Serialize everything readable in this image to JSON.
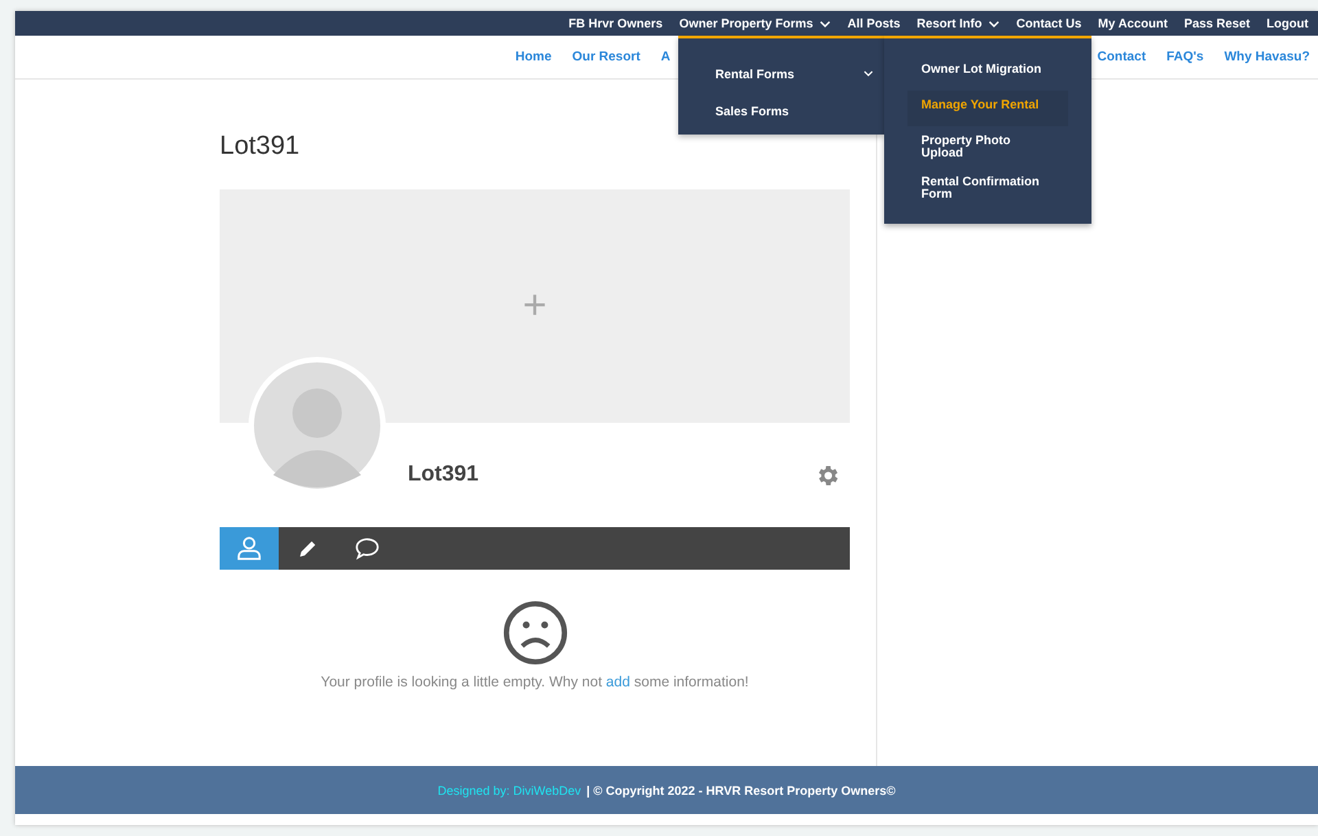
{
  "top_menu": [
    {
      "label": "FB Hrvr Owners",
      "has_submenu": false
    },
    {
      "label": "Owner Property Forms",
      "has_submenu": true
    },
    {
      "label": "All Posts",
      "has_submenu": false
    },
    {
      "label": "Resort Info",
      "has_submenu": true
    },
    {
      "label": "Contact Us",
      "has_submenu": false
    },
    {
      "label": "My Account",
      "has_submenu": false
    },
    {
      "label": "Pass Reset",
      "has_submenu": false
    },
    {
      "label": "Logout",
      "has_submenu": false
    }
  ],
  "main_menu": [
    "Home",
    "Our Resort",
    "A",
    "Contact",
    "FAQ's",
    "Why Havasu?"
  ],
  "dropdown": [
    {
      "label": "Rental Forms",
      "has_submenu": true
    },
    {
      "label": "Sales Forms",
      "has_submenu": false
    }
  ],
  "submenu": [
    {
      "label": "Owner Lot Migration",
      "selected": false
    },
    {
      "label": "Manage Your Rental",
      "selected": true
    },
    {
      "label": "Property Photo Upload",
      "selected": false
    },
    {
      "label": "Rental Confirmation Form",
      "selected": false
    }
  ],
  "page_title": "Lot391",
  "profile": {
    "name": "Lot391",
    "cover_add": "+"
  },
  "profile_tabs": [
    {
      "kind": "profile",
      "selected": true
    },
    {
      "kind": "edit",
      "selected": false
    },
    {
      "kind": "comments",
      "selected": false
    }
  ],
  "empty_message": {
    "before": "Your profile is looking a little empty. Why not ",
    "link": "add",
    "after": " some information!"
  },
  "footer": {
    "credit": "Designed by: DiviWebDev",
    "copyright": "| © Copyright 2022 - HRVR Resort Property Owners©"
  }
}
